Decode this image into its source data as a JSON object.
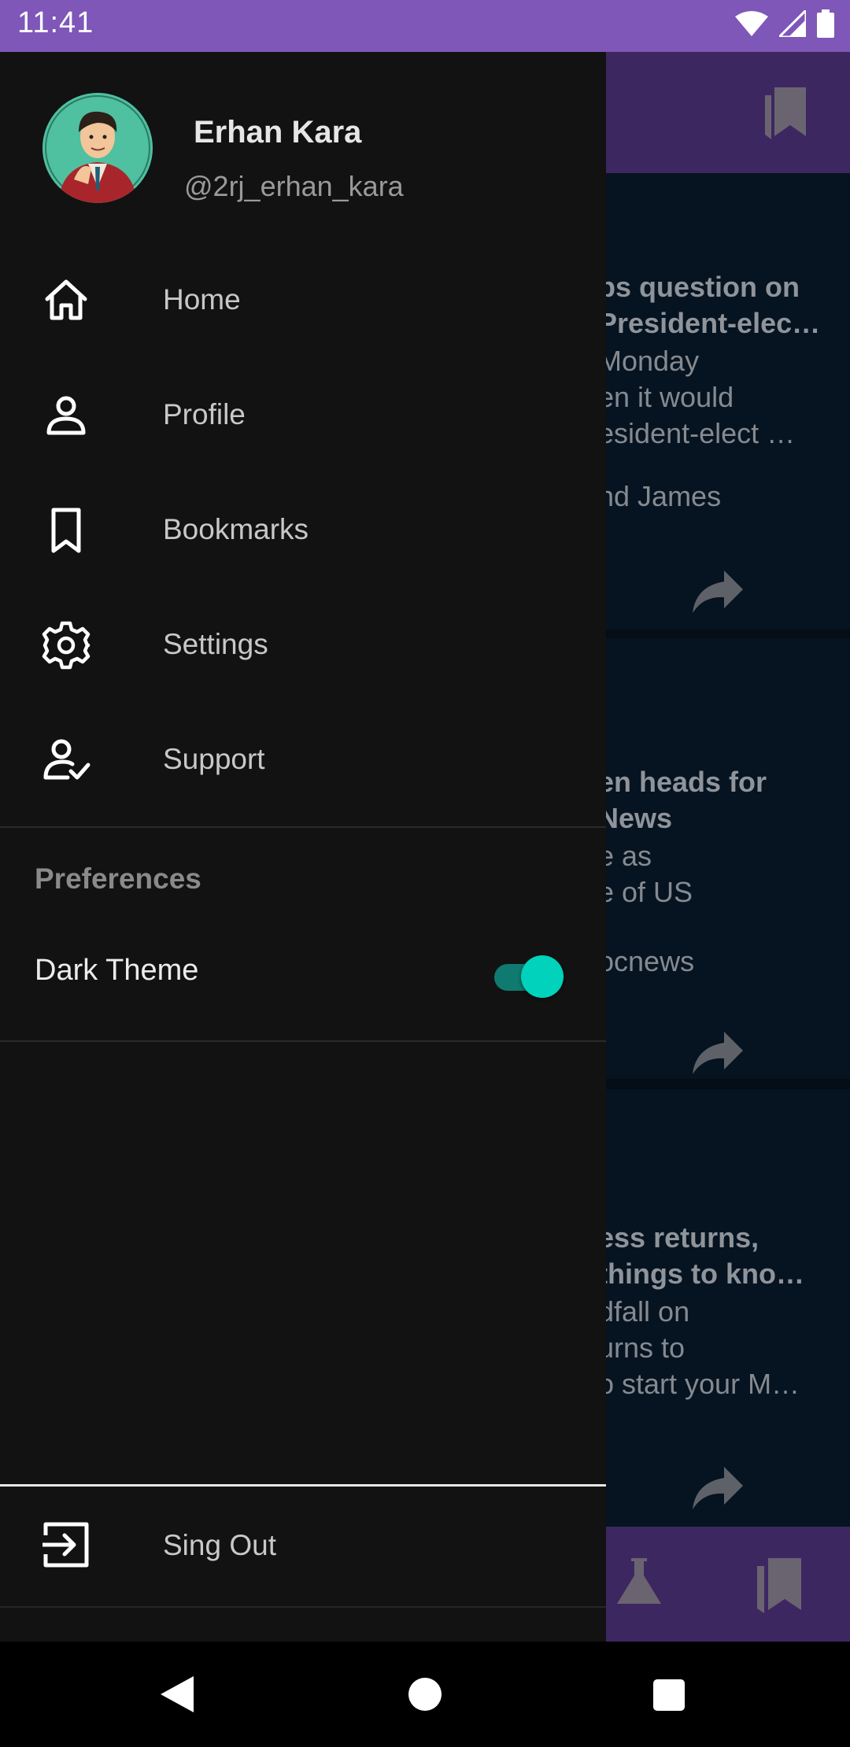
{
  "status_bar": {
    "time": "11:41",
    "icons": [
      "wifi-icon",
      "signal-icon",
      "battery-icon"
    ]
  },
  "user": {
    "name": "Erhan Kara",
    "handle": "@2rj_erhan_kara"
  },
  "menu": [
    {
      "label": "Home",
      "icon": "home-icon"
    },
    {
      "label": "Profile",
      "icon": "person-icon"
    },
    {
      "label": "Bookmarks",
      "icon": "bookmark-icon"
    },
    {
      "label": "Settings",
      "icon": "gear-icon"
    },
    {
      "label": "Support",
      "icon": "person-check-icon"
    }
  ],
  "preferences": {
    "title": "Preferences",
    "dark_theme": {
      "label": "Dark Theme",
      "enabled": true
    }
  },
  "signout": {
    "label": "Sing Out",
    "icon": "exit-icon"
  },
  "background_feed": [
    {
      "title_lines": [
        "ps question on",
        "President-elec…"
      ],
      "desc_lines": [
        "Monday",
        "en it would",
        "esident-elect …"
      ],
      "source": "nd James"
    },
    {
      "title_lines": [
        "en heads for",
        "News"
      ],
      "desc_lines": [
        "e as",
        "e of US"
      ],
      "source": "ocnews"
    },
    {
      "title_lines": [
        "ess returns,",
        "things to kno…"
      ],
      "desc_lines": [
        "dfall on",
        "urns to",
        "o start your M…"
      ],
      "source": ""
    }
  ],
  "colors": {
    "status_bar": "#7e57b8",
    "drawer_bg": "#121212",
    "toggle_accent": "#00d2bc",
    "app_bar_dimmed": "#3d2761"
  }
}
